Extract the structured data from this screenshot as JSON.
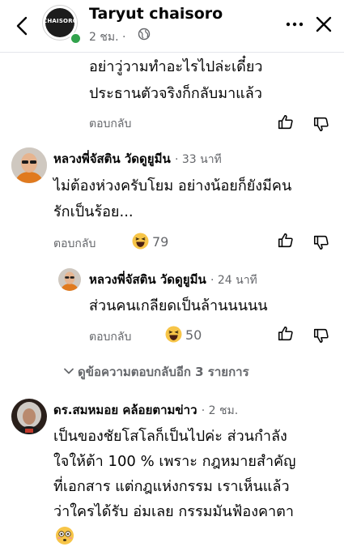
{
  "header": {
    "page_name": "Taryut chaisoro",
    "avatar_logo_text": "CHAISORO",
    "time": "2 ชม.",
    "separator": "·"
  },
  "comments": [
    {
      "lines": [
        "อย่าวู่วามทำอะไรไปล่ะเดี๋ยว",
        "ประธานตัวจริงก็กลับมาแล้ว"
      ],
      "reply_label": "ตอบกลับ"
    },
    {
      "author": "หลวงพี่จัสติน วัดดูยูมีน",
      "time": "· 33 นาที",
      "lines": [
        "ไม่ต้องห่วงครับโยม อย่างน้อยก็ยังมีคน",
        "รักเป็นร้อย..."
      ],
      "reply_label": "ตอบกลับ",
      "reaction_count": "79",
      "reaction_icon": "haha-emoji-icon"
    },
    {
      "author": "หลวงพี่จัสติน วัดดูยูมีน",
      "time": "· 24 นาที",
      "lines": [
        "ส่วนคนเกลียดเป็นล้านนนนน"
      ],
      "reply_label": "ตอบกลับ",
      "reaction_count": "50",
      "reaction_icon": "haha-emoji-icon"
    },
    {
      "author": "ดร.สมหมอย คล้อยตามข่าว",
      "time": "· 2 ชม.",
      "lines": [
        "เป็นของชัยโสโลก็เป็นไปค่ะ ส่วนกำลัง",
        "ใจให้ต้า 100 %  เพราะ กฎหมายสำคัญ",
        "ที่เอกสาร  แต่กฎแห่งกรรม เราเห็นแล้ว",
        "ว่าใครได้รับ อ่มเลย กรรมมันฟ้องคาตา"
      ],
      "trailing_icon": "flushed-emoji-icon"
    }
  ],
  "view_more_replies": "ดูข้อความตอบกลับอีก 3 รายการ",
  "colors": {
    "secondary_text": "#65676b",
    "online": "#31a24c",
    "emoji_yellow": "#f7c548"
  }
}
